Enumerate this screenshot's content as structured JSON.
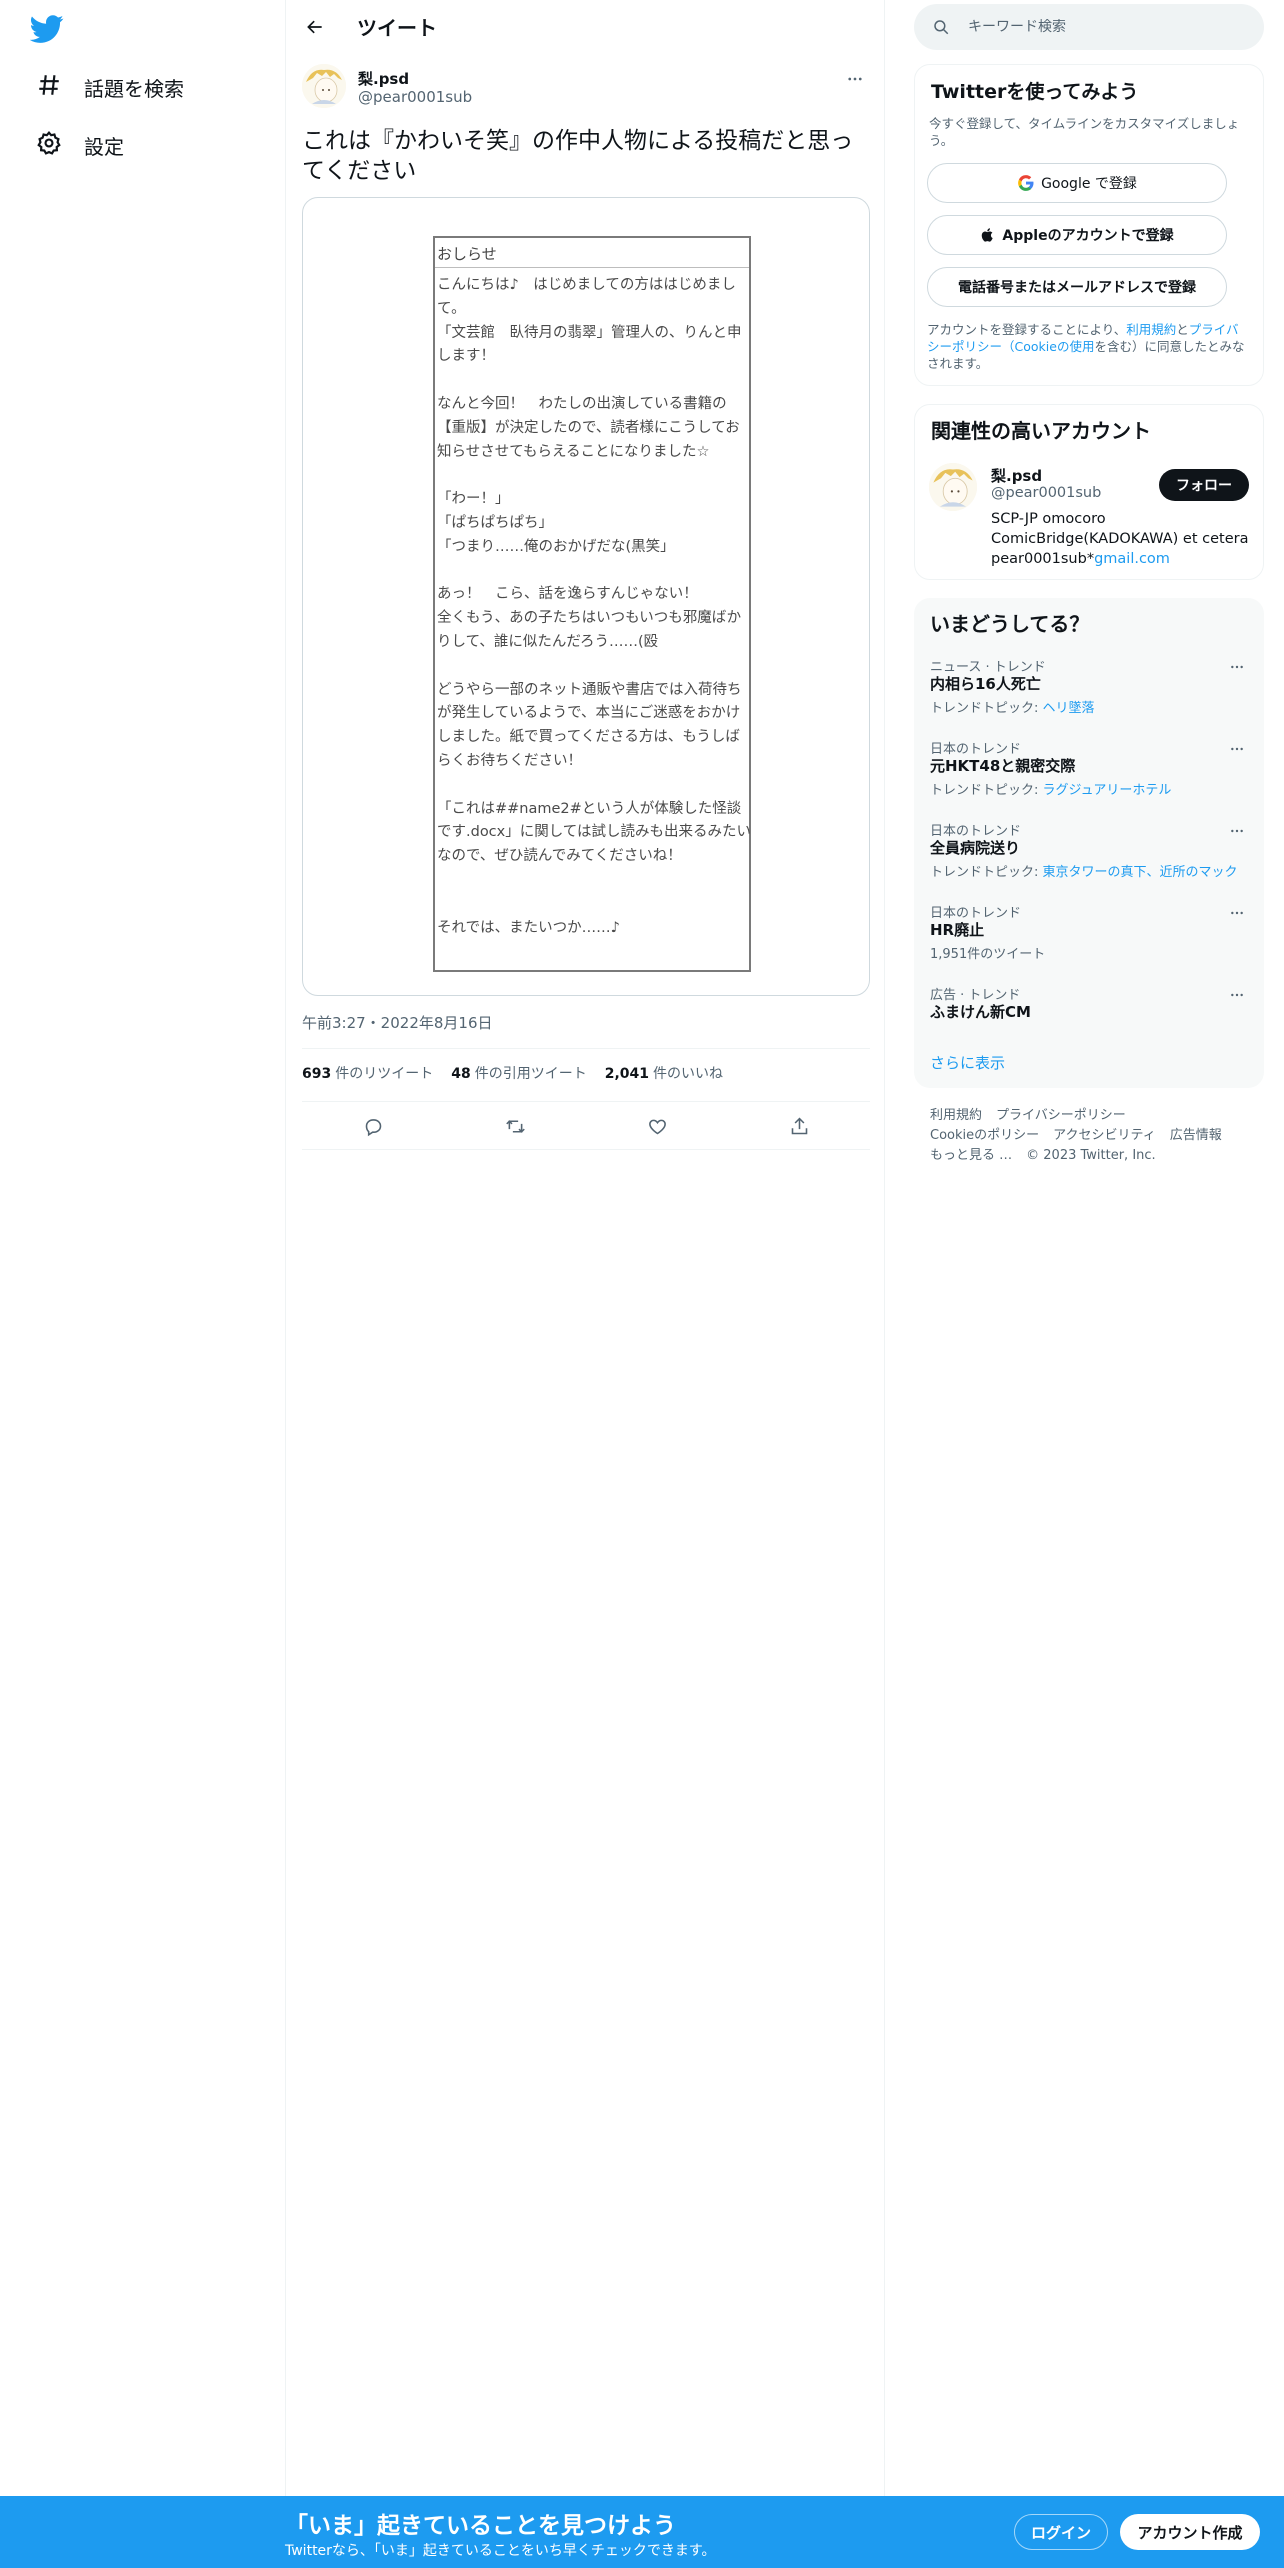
{
  "nav": {
    "items": [
      {
        "label": "話題を検索",
        "icon": "hashtag-icon"
      },
      {
        "label": "設定",
        "icon": "gear-icon"
      }
    ]
  },
  "header": {
    "title": "ツイート"
  },
  "tweet": {
    "author_name": "梨.psd",
    "author_handle": "@pear0001sub",
    "text": "これは『かわいそ笑』の作中人物による投稿だと思ってください",
    "image": {
      "title": "おしらせ",
      "body": "こんにちは♪　はじめましての方ははじめまして。\n「文芸館　臥待月の翡翠」管理人の、りんと申します！\n\nなんと今回！　わたしの出演している書籍の【重版】が決定したので、読者様にこうしてお知らせさせてもらえることになりました☆\n\n「わー！」\n「ぱちぱちぱち」\n「つまり……俺のおかげだな(黒笑」\n\nあっ！　こら、話を逸らすんじゃない！\n全くもう、あの子たちはいつもいつも邪魔ばかりして、誰に似たんだろう……(殴\n\nどうやら一部のネット通販や書店では入荷待ちが発生しているようで、本当にご迷惑をおかけしました。紙で買ってくださる方は、もうしばらくお待ちください！\n\n「これは##name2#という人が体験した怪談です.docx」に関しては試し読みも出来るみたいなので、ぜひ読んでみてくださいね！\n\n\nそれでは、またいつか……♪"
    },
    "timestamp": "午前3:27・2022年8月16日",
    "stats": {
      "retweets_count": "693",
      "retweets_label": "件のリツイート",
      "quotes_count": "48",
      "quotes_label": "件の引用ツイート",
      "likes_count": "2,041",
      "likes_label": "件のいいね"
    }
  },
  "search": {
    "placeholder": "キーワード検索"
  },
  "signup_card": {
    "title": "Twitterを使ってみよう",
    "subtitle": "今すぐ登録して、タイムラインをカスタマイズしましょう。",
    "google_label": "Google で登録",
    "apple_label": "Appleのアカウントで登録",
    "phone_label": "電話番号またはメールアドレスで登録",
    "legal_prefix": "アカウントを登録することにより、",
    "legal_terms": "利用規約",
    "legal_and": "と",
    "legal_privacy": "プライバシーポリシー",
    "legal_paren_open": "（",
    "legal_cookie": "Cookieの使用",
    "legal_suffix": "を含む）に同意したとみなされます。"
  },
  "relevant": {
    "title": "関連性の高いアカウント",
    "name": "梨.psd",
    "handle": "@pear0001sub",
    "follow_label": "フォロー",
    "bio": "SCP-JP omocoro ComicBridge(KADOKAWA) et cetera pear0001sub*",
    "bio_link": "gmail.com"
  },
  "trends": {
    "title": "いまどうしてる？",
    "items": [
      {
        "context": "ニュース · トレンド",
        "name": "内相ら16人死亡",
        "meta_prefix": "トレンドトピック: ",
        "meta_links": "ヘリ墜落"
      },
      {
        "context": "日本のトレンド",
        "name": "元HKT48と親密交際",
        "meta_prefix": "トレンドトピック: ",
        "meta_links": "ラグジュアリーホテル"
      },
      {
        "context": "日本のトレンド",
        "name": "全員病院送り",
        "meta_prefix": "トレンドトピック: ",
        "meta_links": "東京タワーの真下、近所のマック"
      },
      {
        "context": "日本のトレンド",
        "name": "HR廃止",
        "meta_prefix": "1,951件のツイート",
        "meta_links": ""
      },
      {
        "context": "広告 · トレンド",
        "name": "ふまけん新CM",
        "meta_prefix": "",
        "meta_links": ""
      }
    ],
    "show_more": "さらに表示"
  },
  "footer": {
    "links": [
      "利用規約",
      "プライバシーポリシー",
      "Cookieのポリシー",
      "アクセシビリティ",
      "広告情報",
      "もっと見る …"
    ],
    "copyright": "© 2023 Twitter, Inc."
  },
  "bottom_bar": {
    "title": "「いま」起きていることを見つけよう",
    "subtitle": "Twitterなら、「いま」起きていることをいち早くチェックできます。",
    "login_label": "ログイン",
    "signup_label": "アカウント作成"
  },
  "colors": {
    "brand_blue": "#1d9bf0",
    "text_primary": "#0f1419",
    "text_secondary": "#536471"
  }
}
